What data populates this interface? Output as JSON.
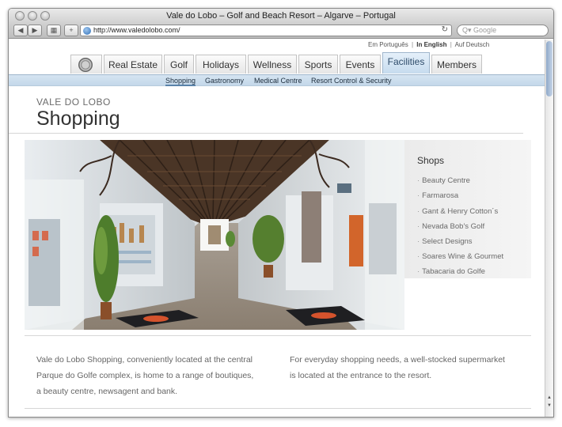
{
  "browser": {
    "window_title": "Vale do Lobo – Golf and Beach Resort – Algarve – Portugal",
    "back_glyph": "◀",
    "forward_glyph": "▶",
    "grid_glyph": "▦",
    "add_glyph": "+",
    "url": "http://www.valedolobo.com/",
    "reload_glyph": "↻",
    "search_placeholder": "Google",
    "search_glyph": "Q▾"
  },
  "languages": {
    "pt": "Em Português",
    "en": "In English",
    "de": "Auf Deutsch",
    "separator": "|"
  },
  "nav": {
    "tabs": [
      "Real Estate",
      "Golf",
      "Holidays",
      "Wellness",
      "Sports",
      "Events",
      "Facilities",
      "Members"
    ],
    "active": "Facilities"
  },
  "subnav": {
    "items": [
      "Shopping",
      "Gastronomy",
      "Medical Centre",
      "Resort Control & Security"
    ],
    "active": "Shopping"
  },
  "page": {
    "kicker": "VALE DO LOBO",
    "title": "Shopping"
  },
  "shops": {
    "title": "Shops",
    "bullet": "·",
    "items": [
      "Beauty Centre",
      "Farmarosa",
      "Gant & Henry Cotton´s",
      "Nevada Bob's Golf",
      "Select Designs",
      "Soares Wine & Gourmet",
      "Tabacaria do Golfe"
    ]
  },
  "body": {
    "paragraph_left": "Vale do Lobo Shopping, conveniently located at the central Parque do Golfe complex, is home to a range of boutiques, a beauty centre, newsagent and bank.",
    "paragraph_right": "For everyday shopping needs, a well-stocked supermarket is located at the entrance to the resort."
  },
  "colors": {
    "active_tab": "#c6dbee",
    "subnav_bg": "#d5e4f1",
    "title_text": "#333333",
    "body_text": "#666666"
  }
}
